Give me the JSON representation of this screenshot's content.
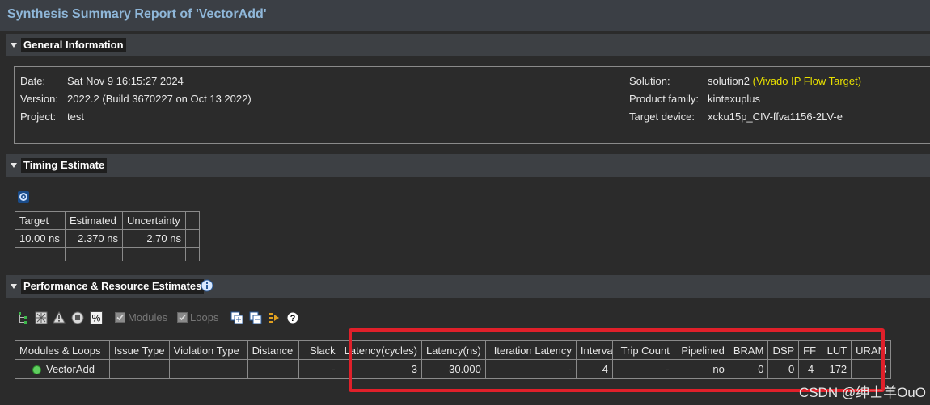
{
  "title": "Synthesis Summary Report of 'VectorAdd'",
  "general": {
    "header": "General Information",
    "left": [
      {
        "label": "Date:",
        "value": "Sat Nov 9 16:15:27 2024"
      },
      {
        "label": "Version:",
        "value": "2022.2 (Build 3670227 on Oct 13 2022)"
      },
      {
        "label": "Project:",
        "value": "test"
      }
    ],
    "right": [
      {
        "label": "Solution:",
        "value": "solution2",
        "extra": " (Vivado IP Flow Target)"
      },
      {
        "label": "Product family:",
        "value": "kintexuplus"
      },
      {
        "label": "Target device:",
        "value": "xcku15p_CIV-ffva1156-2LV-e"
      }
    ]
  },
  "timing": {
    "header": "Timing Estimate",
    "columns": [
      "Target",
      "Estimated",
      "Uncertainty"
    ],
    "row": [
      "10.00 ns",
      "2.370 ns",
      "2.70 ns"
    ]
  },
  "perf": {
    "header": "Performance & Resource Estimates",
    "toolbar": {
      "modules": "Modules",
      "loops": "Loops"
    },
    "columns": [
      "Modules & Loops",
      "Issue Type",
      "Violation Type",
      "Distance",
      "Slack",
      "Latency(cycles)",
      "Latency(ns)",
      "Iteration Latency",
      "Interval",
      "Trip Count",
      "Pipelined",
      "BRAM",
      "DSP",
      "FF",
      "LUT",
      "URAM"
    ],
    "row": [
      "VectorAdd",
      "",
      "",
      "",
      "-",
      "3",
      "30.000",
      "-",
      "4",
      "-",
      "no",
      "0",
      "0",
      "4",
      "172",
      "0"
    ]
  },
  "watermark": "CSDN @绅士羊OuO",
  "colors": {
    "accent_title": "#8fb7d9",
    "highlight_yellow": "#e8e000",
    "annotation_red": "#e0202a"
  }
}
